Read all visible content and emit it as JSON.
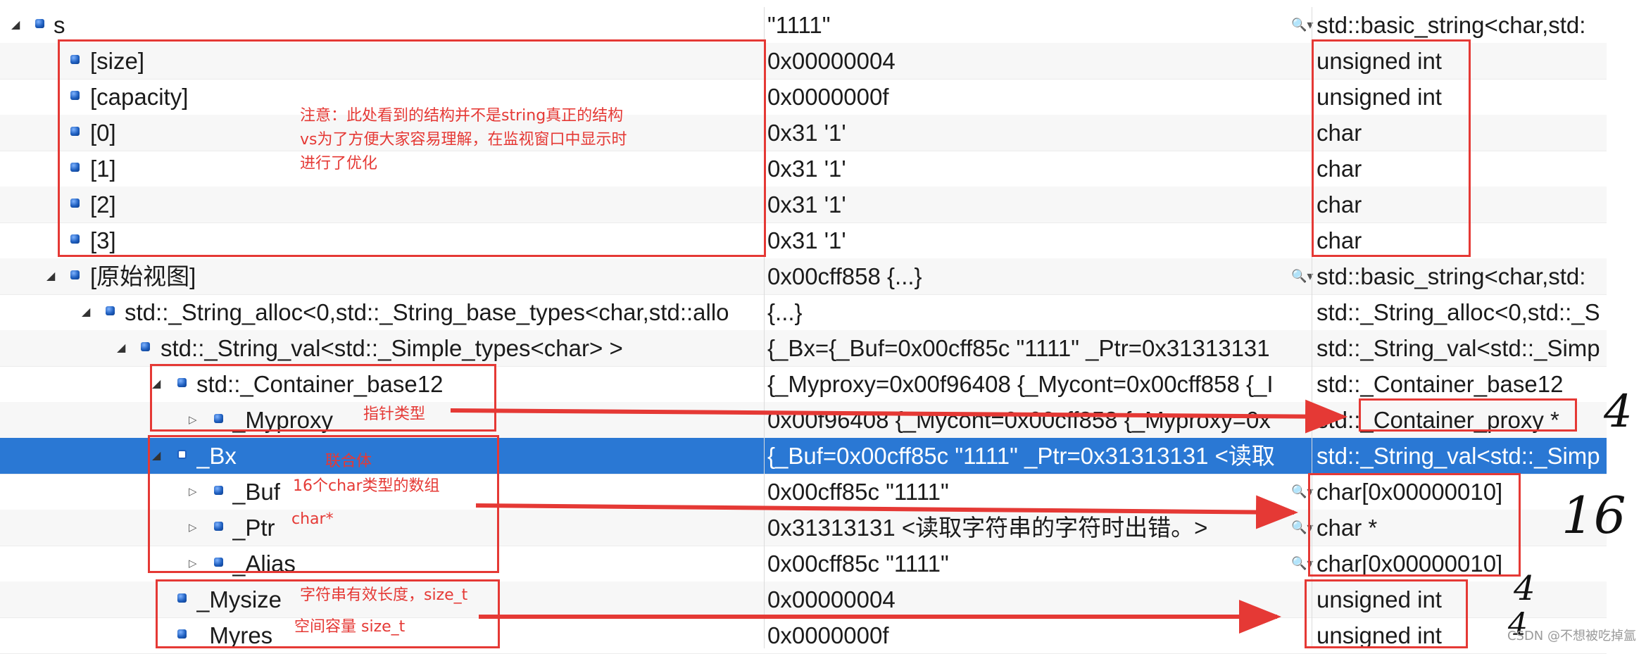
{
  "rows": [
    {
      "name": "s",
      "value": "\"1111\"",
      "type": "std::basic_string<char,std:"
    },
    {
      "name": "[size]",
      "value": "0x00000004",
      "type": "unsigned int"
    },
    {
      "name": "[capacity]",
      "value": "0x0000000f",
      "type": "unsigned int"
    },
    {
      "name": "[0]",
      "value": "0x31 '1'",
      "type": "char"
    },
    {
      "name": "[1]",
      "value": "0x31 '1'",
      "type": "char"
    },
    {
      "name": "[2]",
      "value": "0x31 '1'",
      "type": "char"
    },
    {
      "name": "[3]",
      "value": "0x31 '1'",
      "type": "char"
    },
    {
      "name": "[原始视图]",
      "value": "0x00cff858 {...}",
      "type": "std::basic_string<char,std:"
    },
    {
      "name": "std::_String_alloc<0,std::_String_base_types<char,std::allo",
      "value": "{...}",
      "type": "std::_String_alloc<0,std::_S"
    },
    {
      "name": "std::_String_val<std::_Simple_types<char> >",
      "value": "{_Bx={_Buf=0x00cff85c \"1111\" _Ptr=0x31313131",
      "type": "std::_String_val<std::_Simp"
    },
    {
      "name": "std::_Container_base12",
      "value": "{_Myproxy=0x00f96408 {_Mycont=0x00cff858 {_I",
      "type": "std::_Container_base12"
    },
    {
      "name": "_Myproxy",
      "value": "0x00f96408 {_Mycont=0x00cff858 {_Myproxy=0x",
      "type": "std::_Container_proxy *"
    },
    {
      "name": "_Bx",
      "value": "{_Buf=0x00cff85c \"1111\" _Ptr=0x31313131 <读取",
      "type": "std::_String_val<std::_Simp"
    },
    {
      "name": "_Buf",
      "value": "0x00cff85c \"1111\"",
      "type": "char[0x00000010]"
    },
    {
      "name": "_Ptr",
      "value": "0x31313131 <读取字符串的字符时出错。>",
      "type": "char *"
    },
    {
      "name": "_Alias",
      "value": "0x00cff85c \"1111\"",
      "type": "char[0x00000010]"
    },
    {
      "name": "_Mysize",
      "value": "0x00000004",
      "type": "unsigned int"
    },
    {
      "name": "_Myres",
      "value": "0x0000000f",
      "type": "unsigned int"
    }
  ],
  "annotations": {
    "note_struct": [
      "注意：此处看到的结构并不是string真正的结构",
      "vs为了方便大家容易理解，在监视窗口中显示时",
      "进行了优化"
    ],
    "note_pointer": "指针类型",
    "note_union": "联合体",
    "note_buf": "16个char类型的数组",
    "note_ptr": "char*",
    "note_mysize": "字符串有效长度，size_t",
    "note_myres": "空间容量  size_t",
    "hw_4_a": "4",
    "hw_16": "16",
    "hw_4_b": "4",
    "hw_4_c": "4"
  },
  "watermark": "CSDN @不想被吃掉氲",
  "colors": {
    "selection": "#2a78d4",
    "annotation": "#e53935"
  }
}
